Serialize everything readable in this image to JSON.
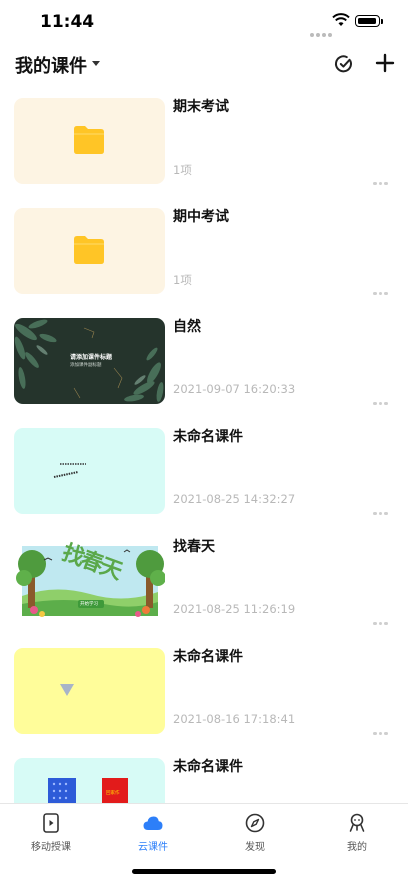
{
  "status": {
    "time": "11:44"
  },
  "header": {
    "title": "我的课件",
    "select_icon": "check-circle-icon",
    "add_icon": "plus-icon"
  },
  "items": [
    {
      "title": "期末考试",
      "meta": "1项",
      "thumb": "folder"
    },
    {
      "title": "期中考试",
      "meta": "1项",
      "thumb": "folder"
    },
    {
      "title": "自然",
      "meta": "2021-09-07 16:20:33",
      "thumb": "nature",
      "thumb_title": "请添加课件标题",
      "thumb_sub": "添加课件副标题"
    },
    {
      "title": "未命名课件",
      "meta": "2021-08-25 14:32:27",
      "thumb": "cyan-text"
    },
    {
      "title": "找春天",
      "meta": "2021-08-25 11:26:19",
      "thumb": "spring",
      "thumb_big": "找春天",
      "thumb_btn": "开始学习"
    },
    {
      "title": "未命名课件",
      "meta": "2021-08-16 17:18:41",
      "thumb": "yellow"
    },
    {
      "title": "未命名课件",
      "meta": "",
      "thumb": "cyan-books",
      "thumb_red": "回家作"
    }
  ],
  "tabs": [
    {
      "label": "移动授课",
      "icon": "play-doc-icon",
      "active": false
    },
    {
      "label": "云课件",
      "icon": "cloud-icon",
      "active": true
    },
    {
      "label": "发现",
      "icon": "compass-icon",
      "active": false
    },
    {
      "label": "我的",
      "icon": "person-icon",
      "active": false
    }
  ],
  "colors": {
    "accent": "#2d7ff9",
    "folder": "#ffc526",
    "folder_bg": "#fdf4e3",
    "cyan_bg": "#d7fbf6",
    "yellow_bg": "#fffd9a"
  }
}
